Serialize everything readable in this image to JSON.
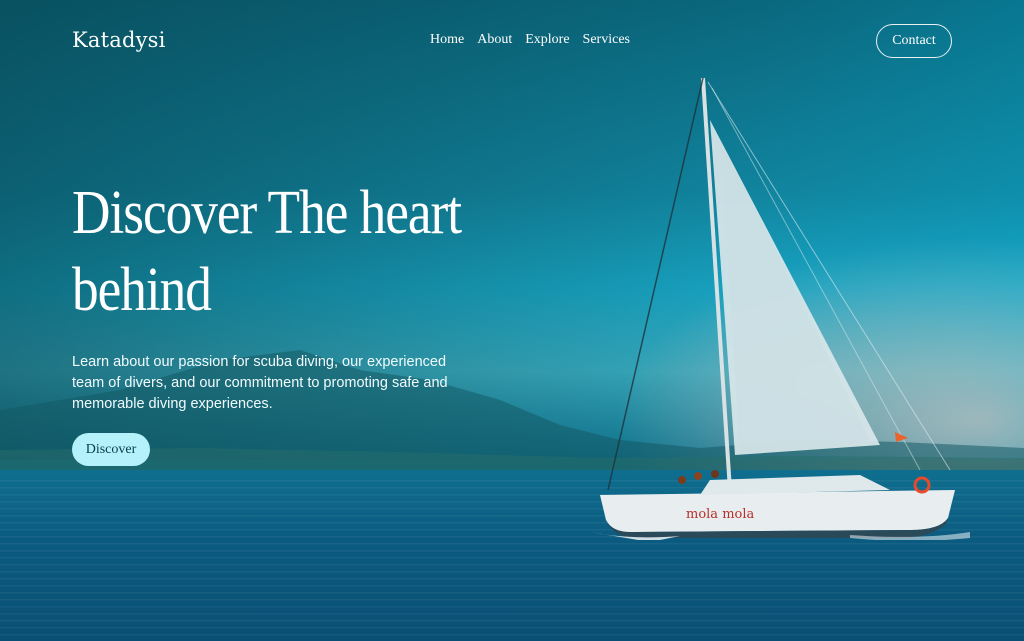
{
  "brand": {
    "name": "Katadysi"
  },
  "nav": {
    "links": [
      "Home",
      "About",
      "Explore",
      "Services"
    ],
    "contact_label": "Contact"
  },
  "hero": {
    "headline_line1": "Discover The heart",
    "headline_line2": "behind",
    "description": "Learn about our passion for scuba diving, our experienced team of divers, and our commitment to promoting safe and memorable diving experiences.",
    "cta_label": "Discover",
    "boat_name": "mola mola"
  },
  "colors": {
    "cta_background": "#b4f1fb",
    "text": "#ffffff",
    "sea": "#0b5b80"
  }
}
